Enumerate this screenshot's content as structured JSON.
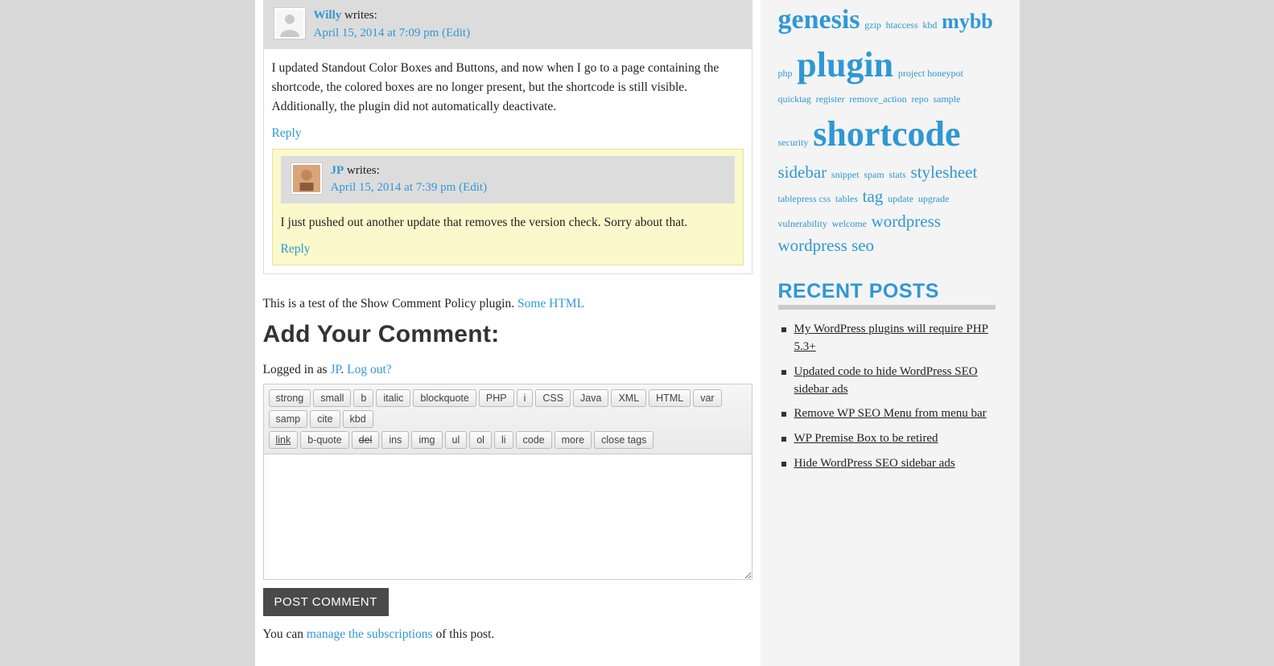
{
  "comments": {
    "c1": {
      "author": "Willy",
      "writes": " writes:",
      "date": "April 15, 2014 at 7:09 pm",
      "edit": "(Edit)",
      "body": "I updated Standout Color Boxes and Buttons, and now when I go to a page containing the shortcode, the colored boxes are no longer present, but the shortcode is still visible. Additionally, the plugin did not automatically deactivate.",
      "reply": "Reply"
    },
    "c2": {
      "author": "JP",
      "writes": " writes:",
      "date": "April 15, 2014 at 7:39 pm",
      "edit": "(Edit)",
      "body": "I just pushed out another update that removes the version check. Sorry about that.",
      "reply": "Reply"
    }
  },
  "policy": {
    "prefix": "This is a test of the Show Comment Policy plugin. ",
    "link": "Some HTML"
  },
  "form": {
    "heading": "Add Your Comment:",
    "logged_in_prefix": "Logged in as ",
    "user": "JP",
    "period": ". ",
    "logout": "Log out?",
    "submit": "POST COMMENT",
    "sub_prefix": "You can ",
    "sub_link": "manage the subscriptions",
    "sub_suffix": " of this post."
  },
  "quicktags": {
    "r1": [
      "strong",
      "small",
      "b",
      "italic",
      "blockquote",
      "PHP",
      "i",
      "CSS",
      "Java",
      "XML",
      "HTML",
      "var",
      "samp",
      "cite",
      "kbd"
    ],
    "r2": [
      "link",
      "b-quote",
      "del",
      "ins",
      "img",
      "ul",
      "ol",
      "li",
      "code",
      "more",
      "close tags"
    ]
  },
  "sidebar": {
    "tags": [
      {
        "t": "genesis",
        "s": 5
      },
      {
        "t": "gzip",
        "s": 1
      },
      {
        "t": "htaccess",
        "s": 1
      },
      {
        "t": "kbd",
        "s": 1
      },
      {
        "t": "mybb",
        "s": 4
      },
      {
        "t": "php",
        "s": 1
      },
      {
        "t": "plugin",
        "s": 6
      },
      {
        "t": "project honeypot",
        "s": 1
      },
      {
        "t": "quicktag",
        "s": 1
      },
      {
        "t": "register",
        "s": 1
      },
      {
        "t": "remove_action",
        "s": 1
      },
      {
        "t": "repo",
        "s": 1
      },
      {
        "t": "sample",
        "s": 1
      },
      {
        "t": "security",
        "s": 1
      },
      {
        "t": "shortcode",
        "s": 6
      },
      {
        "t": "sidebar",
        "s": 3
      },
      {
        "t": "snippet",
        "s": 1
      },
      {
        "t": "spam",
        "s": 1
      },
      {
        "t": "stats",
        "s": 1
      },
      {
        "t": "stylesheet",
        "s": 3
      },
      {
        "t": "tablepress css",
        "s": 1
      },
      {
        "t": "tables",
        "s": 1
      },
      {
        "t": "tag",
        "s": 3
      },
      {
        "t": "update",
        "s": 1
      },
      {
        "t": "upgrade",
        "s": 1
      },
      {
        "t": "vulnerability",
        "s": 1
      },
      {
        "t": "welcome",
        "s": 1
      },
      {
        "t": "wordpress",
        "s": 3
      },
      {
        "t": "wordpress seo",
        "s": 3
      }
    ],
    "recent_heading": "RECENT POSTS",
    "recent": [
      "My WordPress plugins will require PHP 5.3+",
      "Updated code to hide WordPress SEO sidebar ads",
      "Remove WP SEO Menu from menu bar",
      "WP Premise Box to be retired",
      "Hide WordPress SEO sidebar ads"
    ]
  }
}
